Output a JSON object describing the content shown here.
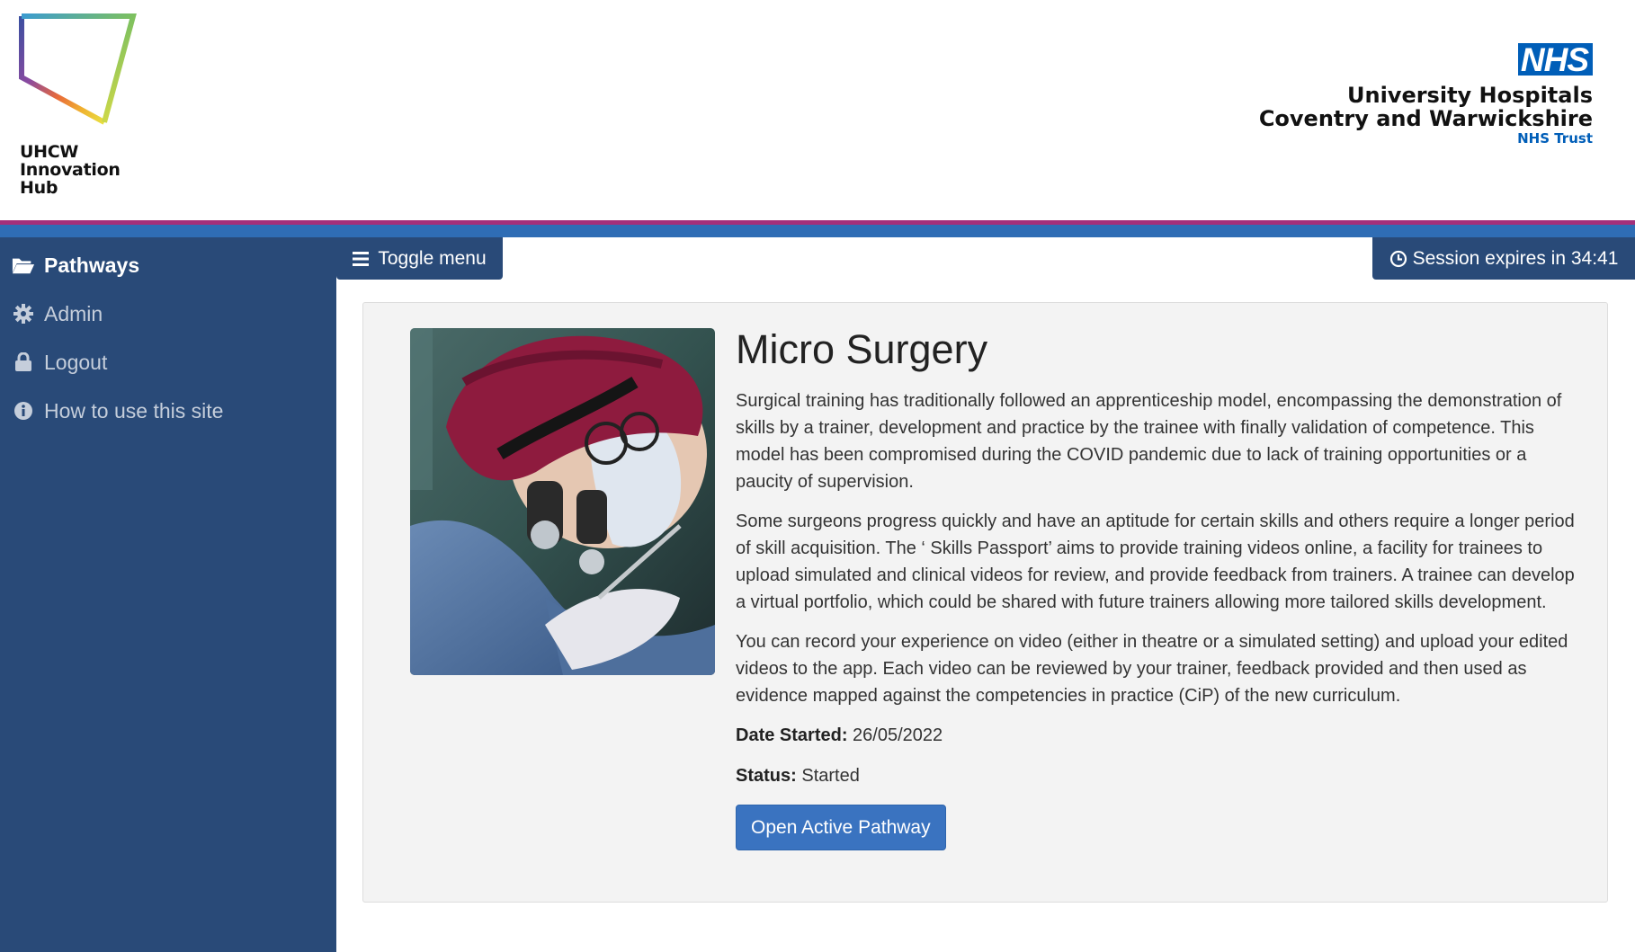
{
  "header": {
    "hub_logo_lines": [
      "UHCW",
      "Innovation",
      "Hub"
    ],
    "nhs_badge": "NHS",
    "nhs_org_line1": "University Hospitals",
    "nhs_org_line2": "Coventry and Warwickshire",
    "nhs_trust": "NHS Trust"
  },
  "sidebar": {
    "items": [
      {
        "label": "Pathways",
        "icon": "folder-open-icon",
        "active": true
      },
      {
        "label": "Admin",
        "icon": "gear-icon",
        "active": false
      },
      {
        "label": "Logout",
        "icon": "lock-icon",
        "active": false
      },
      {
        "label": "How to use this site",
        "icon": "info-icon",
        "active": false
      }
    ]
  },
  "toolbar": {
    "toggle_label": "Toggle menu",
    "session_label": "Session expires in 34:41"
  },
  "pathway": {
    "title": "Micro Surgery",
    "paragraphs": [
      "Surgical training has traditionally followed an apprenticeship model, encompassing the demonstration of skills by a trainer, development and practice by the trainee with finally validation of competence. This model has been compromised during the COVID pandemic due to lack of training opportunities or a paucity of supervision.",
      "Some surgeons progress quickly and have an aptitude for certain skills and others require a longer period of skill acquisition. The ‘ Skills Passport’ aims to provide training videos online, a facility for trainees to upload simulated and clinical videos for review, and provide feedback from trainers. A trainee can develop a virtual portfolio, which could be shared with future trainers allowing more tailored skills development.",
      "You can record your experience on video (either in theatre or a simulated setting) and upload your edited videos to the app. Each video can be reviewed by your trainer, feedback provided and then used as evidence mapped against the competencies in practice (CiP) of the new curriculum."
    ],
    "date_started_label": "Date Started:",
    "date_started_value": "26/05/2022",
    "status_label": "Status:",
    "status_value": "Started",
    "button_label": "Open Active Pathway"
  },
  "colors": {
    "sidebar_bg": "#294a78",
    "stripe_pink": "#a4307a",
    "stripe_blue": "#2f6db5",
    "nhs_blue": "#005eb8",
    "button_blue": "#3a73c0"
  }
}
